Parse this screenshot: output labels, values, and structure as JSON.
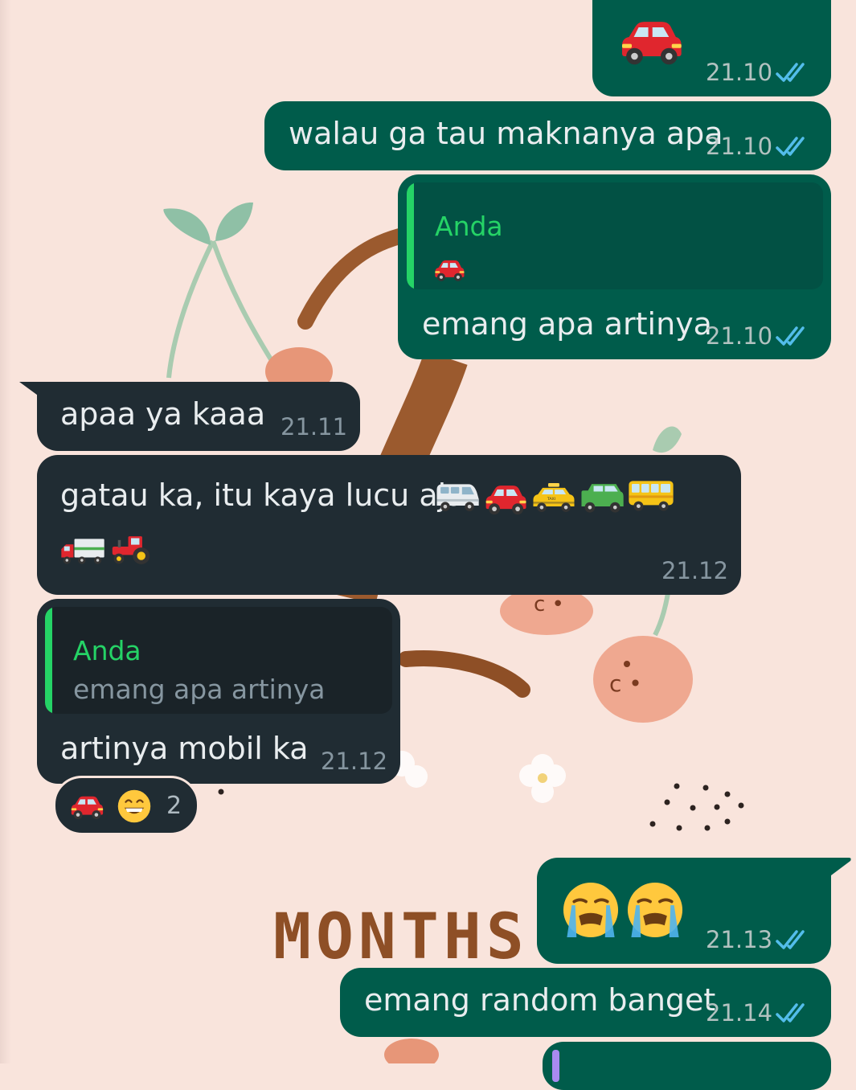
{
  "colors": {
    "chat_background": "#f9e4dc",
    "outgoing_bubble": "#005c4b",
    "incoming_bubble": "#202c33",
    "read_ticks": "#53bdeb",
    "quote_author": "#25d366"
  },
  "wallpaper": {
    "text": "MONTHS"
  },
  "messages": [
    {
      "direction": "out",
      "content": "car-emoji",
      "time": "21.10",
      "status": "read"
    },
    {
      "direction": "out",
      "text": "walau ga tau maknanya apa",
      "time": "21.10",
      "status": "read"
    },
    {
      "direction": "out",
      "reply": {
        "author": "Anda",
        "content": "car-emoji"
      },
      "text": "emang apa artinya",
      "time": "21.10",
      "status": "read"
    },
    {
      "direction": "in",
      "text": "apaa ya kaaa",
      "time": "21.11"
    },
    {
      "direction": "in",
      "text": "gatau ka, itu kaya lucu aja",
      "emojis": [
        "minibus-emoji",
        "car-emoji",
        "taxi-emoji",
        "suv-emoji",
        "bus-emoji",
        "truck-emoji",
        "tractor-emoji"
      ],
      "time": "21.12"
    },
    {
      "direction": "in",
      "reply": {
        "author": "Anda",
        "text": "emang apa artinya"
      },
      "text": "artinya mobil ka",
      "time": "21.12",
      "reactions": {
        "emojis": [
          "car-emoji",
          "grinning-face-emoji"
        ],
        "count": "2"
      }
    },
    {
      "direction": "out",
      "emojis": [
        "loudly-crying-face-emoji",
        "loudly-crying-face-emoji"
      ],
      "time": "21.13",
      "status": "read"
    },
    {
      "direction": "out",
      "text": "emang random banget",
      "time": "21.14",
      "status": "read"
    }
  ]
}
